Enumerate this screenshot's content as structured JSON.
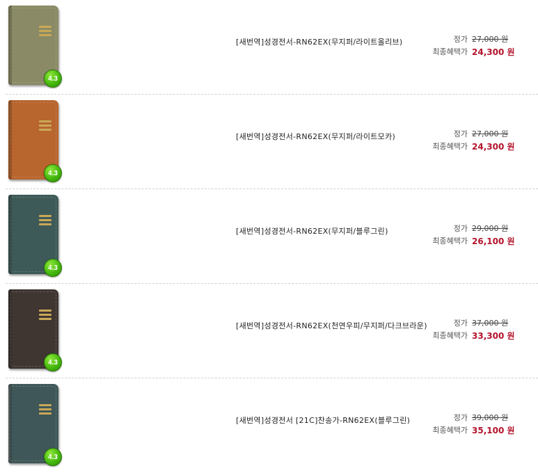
{
  "labels": {
    "list_price": "정가",
    "final_price": "최종혜택가"
  },
  "products": [
    {
      "title": "[새번역]성경전서-RN62EX(무지퍼/라이트올리브)",
      "rating": "4.3",
      "list_price": "27,000 원",
      "final_price": "24,300 원",
      "cover_color": "#8a8a66",
      "zipper": false
    },
    {
      "title": "[새번역]성경전서-RN62EX(무지퍼/라이트모카)",
      "rating": "4.3",
      "list_price": "27,000 원",
      "final_price": "24,300 원",
      "cover_color": "#b8652e",
      "zipper": false
    },
    {
      "title": "[새번역]성경전서-RN62EX(무지퍼/블루그린)",
      "rating": "4.3",
      "list_price": "29,000 원",
      "final_price": "26,100 원",
      "cover_color": "#3e5a58",
      "zipper": false
    },
    {
      "title": "[새번역]성경전서-RN62EX(천연우피/무지퍼/다크브라운)",
      "rating": "4.3",
      "list_price": "37,000 원",
      "final_price": "33,300 원",
      "cover_color": "#3f3632",
      "zipper": false
    },
    {
      "title": "[새번역]성경전서 [21C]찬송가-RN62EX(블루그린)",
      "rating": "4.3",
      "list_price": "39,000 원",
      "final_price": "35,100 원",
      "cover_color": "#3f5758",
      "zipper": true
    }
  ]
}
